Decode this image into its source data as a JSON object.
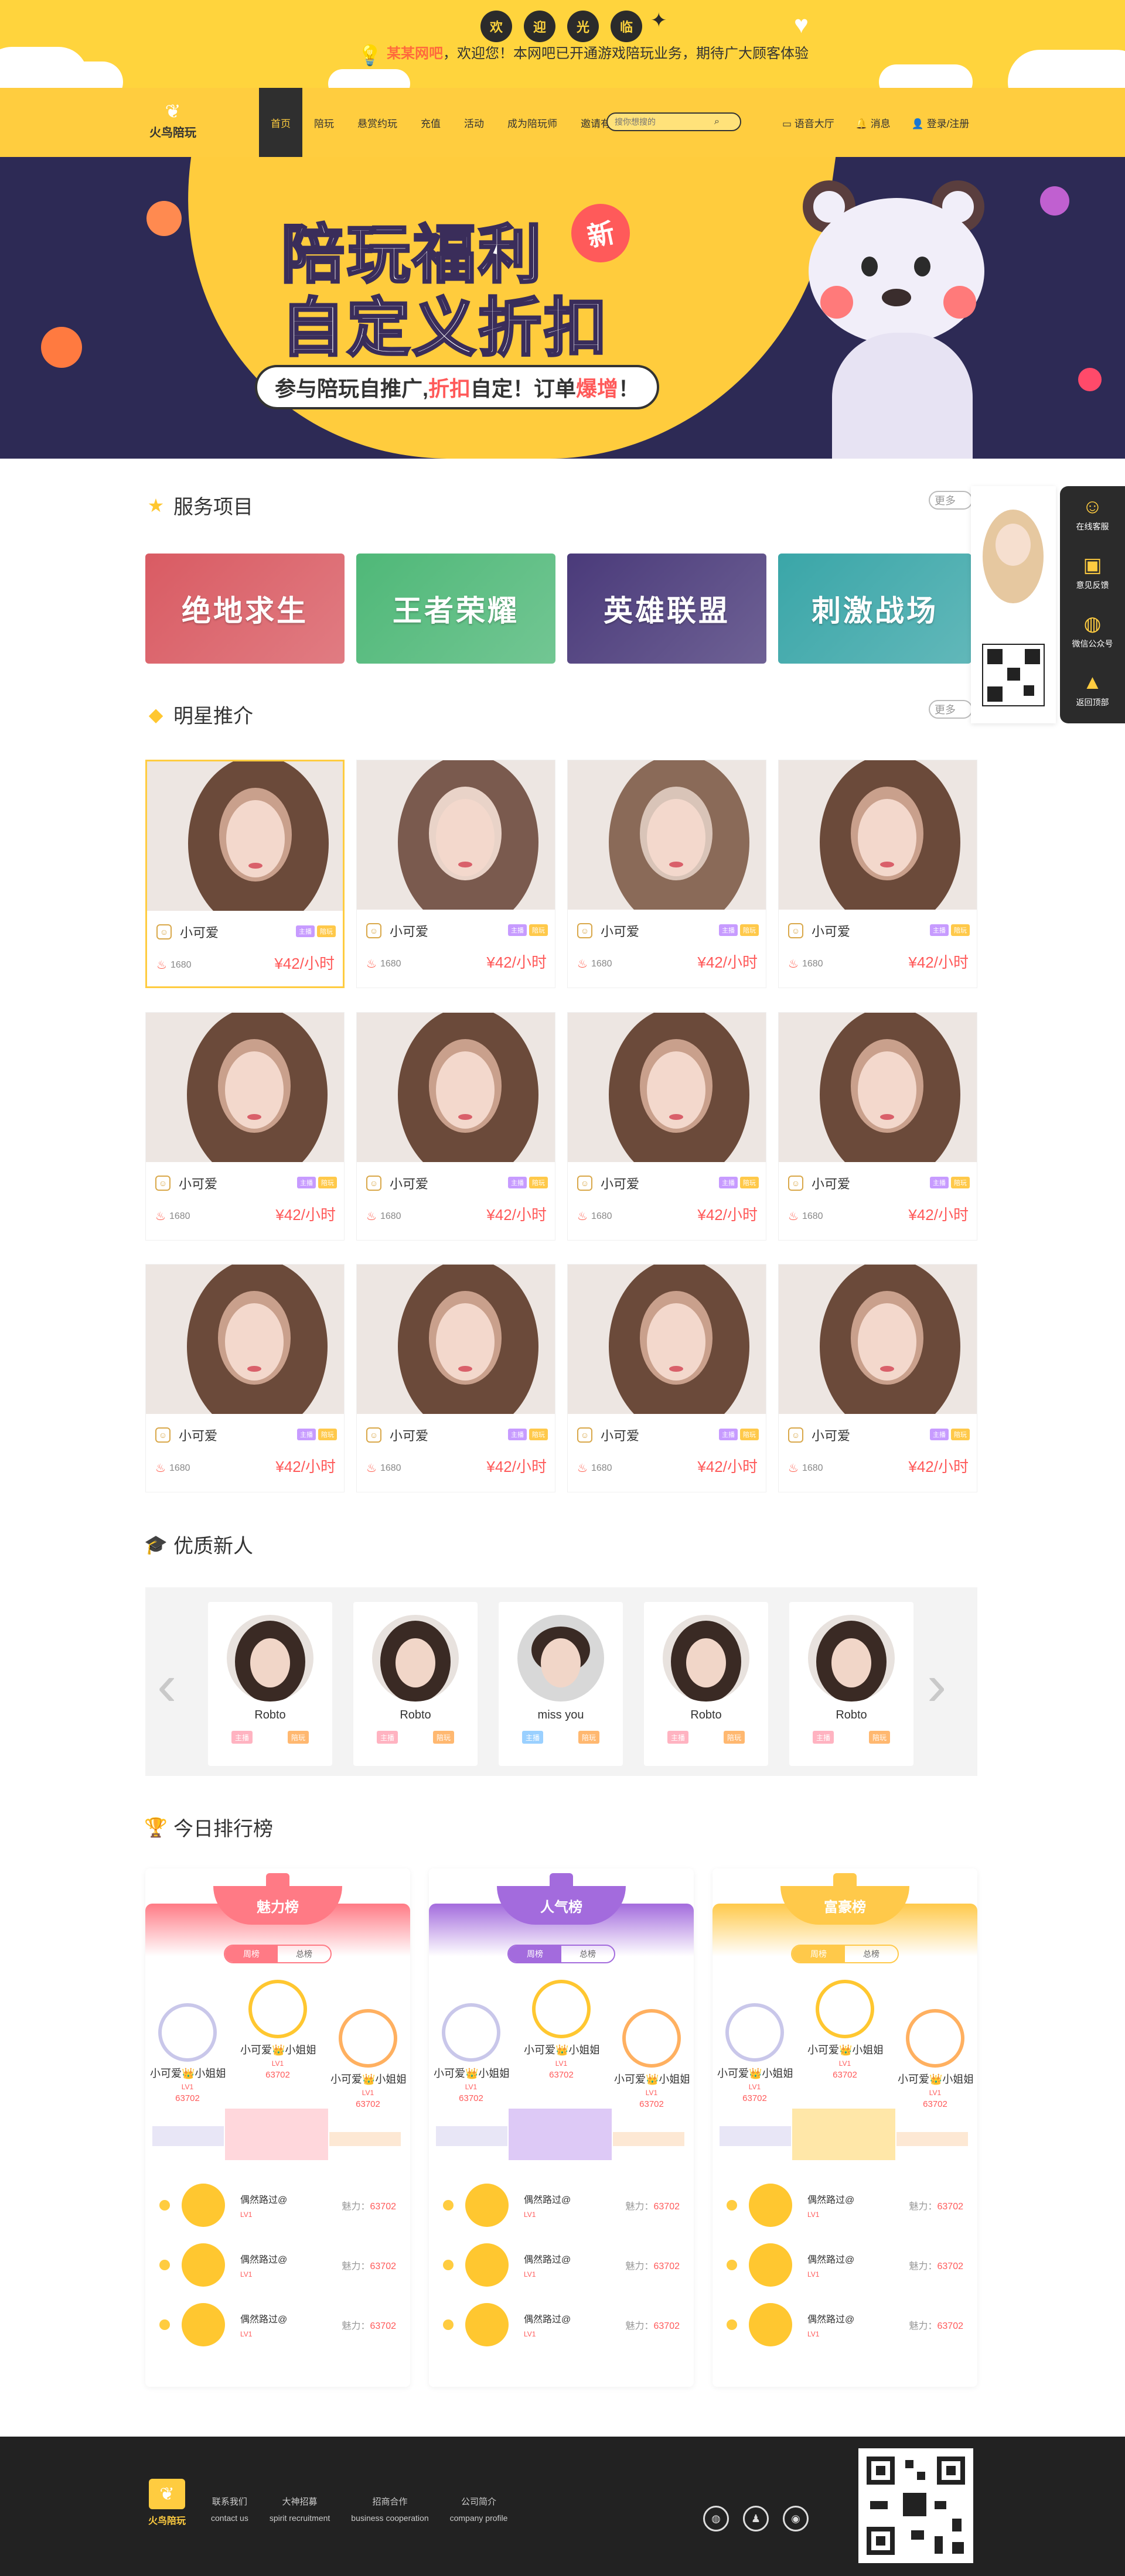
{
  "notice": {
    "bubbles": [
      "欢",
      "迎",
      "光",
      "临"
    ],
    "brand": "某某网吧",
    "message": "，欢迎您！本网吧已开通游戏陪玩业务，期待广大顾客体验"
  },
  "nav": {
    "logo_text": "火鸟陪玩",
    "items": [
      "首页",
      "陪玩",
      "悬赏约玩",
      "充值",
      "活动",
      "成为陪玩师",
      "邀请有礼"
    ],
    "search_placeholder": "搜你想搜的",
    "right": [
      "语音大厅",
      "消息",
      "登录/注册"
    ]
  },
  "banner": {
    "title_line1": "陪玩福利",
    "title_line2": "自定义折扣",
    "new_tag": "新",
    "sub_part1": "参与陪玩自推广,",
    "sub_hl1": "折扣",
    "sub_part2": "自定！订单",
    "sub_hl2": "爆增",
    "sub_part3": "！"
  },
  "services": {
    "title": "服务项目",
    "more": "更多",
    "items": [
      {
        "label": "绝地求生",
        "color": "#d95b63"
      },
      {
        "label": "王者荣耀",
        "color": "#4fb878"
      },
      {
        "label": "英雄联盟",
        "color": "#4a3a7a"
      },
      {
        "label": "刺激战场",
        "color": "#3aa6a8"
      }
    ]
  },
  "stars": {
    "title": "明星推介",
    "more": "更多",
    "cards": [
      {
        "name": "小可爱",
        "tag1": "主播",
        "tag2": "陪玩",
        "count": "1680",
        "price": "¥42/小时"
      },
      {
        "name": "小可爱",
        "tag1": "主播",
        "tag2": "陪玩",
        "count": "1680",
        "price": "¥42/小时"
      },
      {
        "name": "小可爱",
        "tag1": "主播",
        "tag2": "陪玩",
        "count": "1680",
        "price": "¥42/小时"
      },
      {
        "name": "小可爱",
        "tag1": "主播",
        "tag2": "陪玩",
        "count": "1680",
        "price": "¥42/小时"
      },
      {
        "name": "小可爱",
        "tag1": "主播",
        "tag2": "陪玩",
        "count": "1680",
        "price": "¥42/小时"
      },
      {
        "name": "小可爱",
        "tag1": "主播",
        "tag2": "陪玩",
        "count": "1680",
        "price": "¥42/小时"
      },
      {
        "name": "小可爱",
        "tag1": "主播",
        "tag2": "陪玩",
        "count": "1680",
        "price": "¥42/小时"
      },
      {
        "name": "小可爱",
        "tag1": "主播",
        "tag2": "陪玩",
        "count": "1680",
        "price": "¥42/小时"
      },
      {
        "name": "小可爱",
        "tag1": "主播",
        "tag2": "陪玩",
        "count": "1680",
        "price": "¥42/小时"
      },
      {
        "name": "小可爱",
        "tag1": "主播",
        "tag2": "陪玩",
        "count": "1680",
        "price": "¥42/小时"
      },
      {
        "name": "小可爱",
        "tag1": "主播",
        "tag2": "陪玩",
        "count": "1680",
        "price": "¥42/小时"
      },
      {
        "name": "小可爱",
        "tag1": "主播",
        "tag2": "陪玩",
        "count": "1680",
        "price": "¥42/小时"
      }
    ]
  },
  "newcomers": {
    "title": "优质新人",
    "items": [
      {
        "name": "Robto",
        "t1": "主播",
        "t2": "陪玩"
      },
      {
        "name": "Robto",
        "t1": "主播",
        "t2": "陪玩"
      },
      {
        "name": "miss you",
        "t1": "主播",
        "t2": "陪玩"
      },
      {
        "name": "Robto",
        "t1": "主播",
        "t2": "陪玩"
      },
      {
        "name": "Robto",
        "t1": "主播",
        "t2": "陪玩"
      }
    ]
  },
  "ranking": {
    "title": "今日排行榜",
    "tab_week": "周榜",
    "tab_total": "总榜",
    "boards": [
      {
        "name": "魅力榜",
        "color": "#ff7a85"
      },
      {
        "name": "人气榜",
        "color": "#a36bdd"
      },
      {
        "name": "富豪榜",
        "color": "#ffc94a"
      }
    ],
    "podium_name": "小可爱👑小姐姐...",
    "podium_level": "LV1",
    "podium_value": "63702",
    "row_name": "偶然路过@",
    "row_level": "LV1",
    "row_score_label": "魅力：",
    "row_score_value": "63702"
  },
  "float": {
    "items": [
      "在线客服",
      "意见反馈",
      "微信公众号",
      "返回顶部"
    ]
  },
  "footer": {
    "logo_text": "火鸟陪玩",
    "links": [
      {
        "cn": "联系我们",
        "en": "contact us"
      },
      {
        "cn": "大神招募",
        "en": "spirit recruitment"
      },
      {
        "cn": "招商合作",
        "en": "business cooperation"
      },
      {
        "cn": "公司简介",
        "en": "company profile"
      }
    ]
  }
}
